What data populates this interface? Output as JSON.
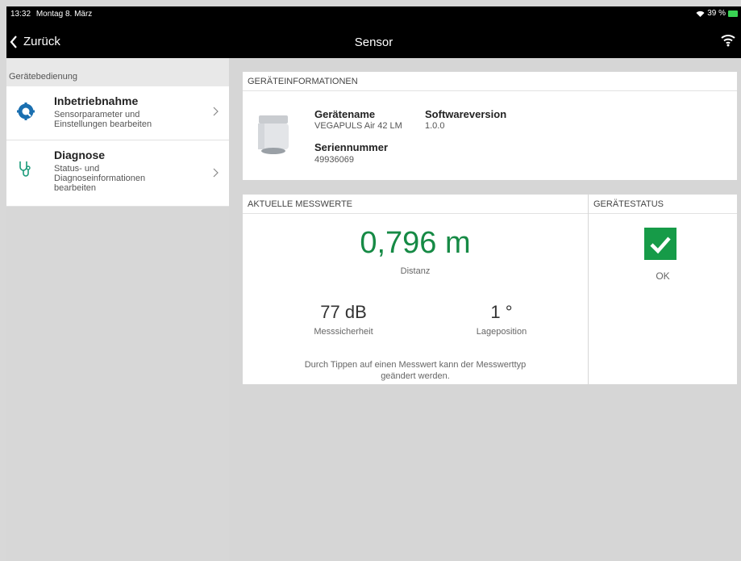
{
  "statusbar": {
    "time": "13:32",
    "date": "Montag 8. März",
    "battery": "39 %"
  },
  "nav": {
    "back_label": "Zurück",
    "title": "Sensor"
  },
  "sidebar": {
    "header": "Gerätebedienung",
    "items": [
      {
        "title": "Inbetriebnahme",
        "desc": "Sensorparameter und Einstellungen bearbeiten"
      },
      {
        "title": "Diagnose",
        "desc": "Status- und Diagnoseinformationen bearbeiten"
      }
    ]
  },
  "device_info": {
    "header": "GERÄTEINFORMATIONEN",
    "name_label": "Gerätename",
    "name_value": "VEGAPULS Air 42 LM",
    "software_label": "Softwareversion",
    "software_value": "1.0.0",
    "serial_label": "Seriennummer",
    "serial_value": "49936069"
  },
  "measurements": {
    "header": "AKTUELLE MESSWERTE",
    "primary_value": "0,796 m",
    "primary_label": "Distanz",
    "secondary_1_value": "77 dB",
    "secondary_1_label": "Messsicherheit",
    "secondary_2_value": "1 °",
    "secondary_2_label": "Lageposition",
    "hint_line1": "Durch Tippen auf einen Messwert kann der Messwerttyp",
    "hint_line2": "geändert werden."
  },
  "device_status": {
    "header": "GERÄTESTATUS",
    "status": "OK"
  },
  "colors": {
    "accent_green": "#168a45",
    "status_green": "#169b48",
    "nav_bar": "#000000"
  }
}
